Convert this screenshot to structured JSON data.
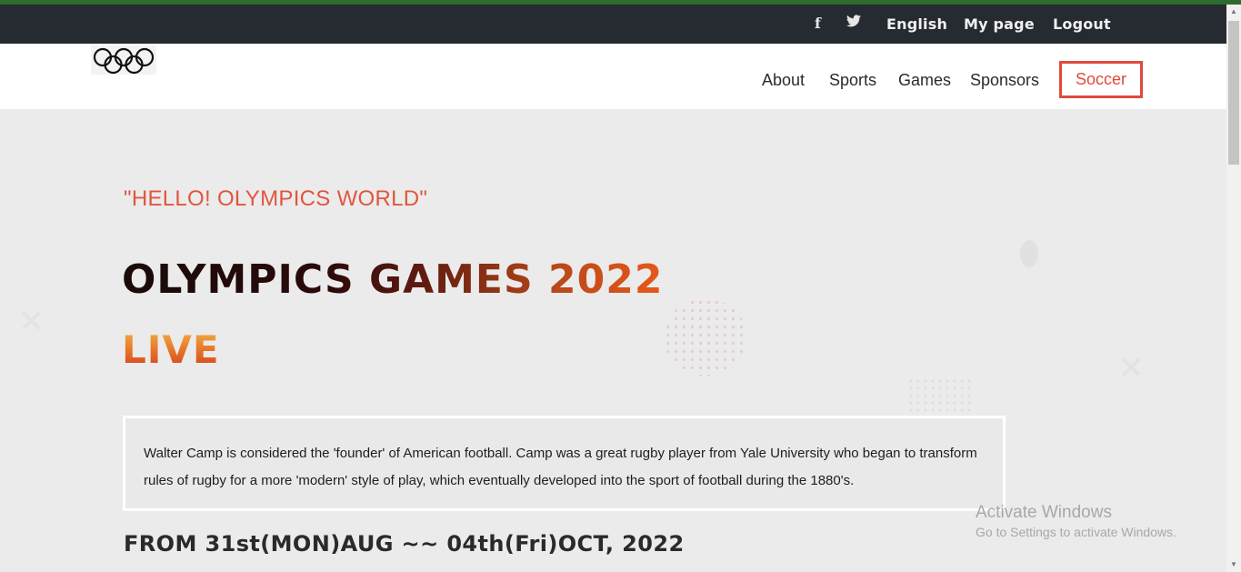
{
  "topbar": {
    "facebook_glyph": "f",
    "twitter_glyph": "🐦",
    "language": "English",
    "my_page": "My page",
    "logout": "Logout"
  },
  "nav": {
    "items": [
      "About",
      "Sports",
      "Games",
      "Sponsors"
    ],
    "active": "Soccer"
  },
  "hero": {
    "tagline": "\"HELLO! OLYMPICS WORLD\"",
    "headline": "OLYMPICS GAMES 2022",
    "live": "LIVE"
  },
  "info": {
    "text": "Walter Camp is considered the 'founder' of American football. Camp was a great rugby player from Yale University who began to transform rules of rugby for a more 'modern' style of play, which eventually developed into the sport of football during the 1880's."
  },
  "dates": "FROM 31st(MON)AUG ~~ 04th(Fri)OCT, 2022",
  "watermark": {
    "title": "Activate Windows",
    "subtitle": "Go to Settings to activate Windows."
  },
  "colors": {
    "accent": "#e04a3a",
    "topbar": "#262a31"
  }
}
